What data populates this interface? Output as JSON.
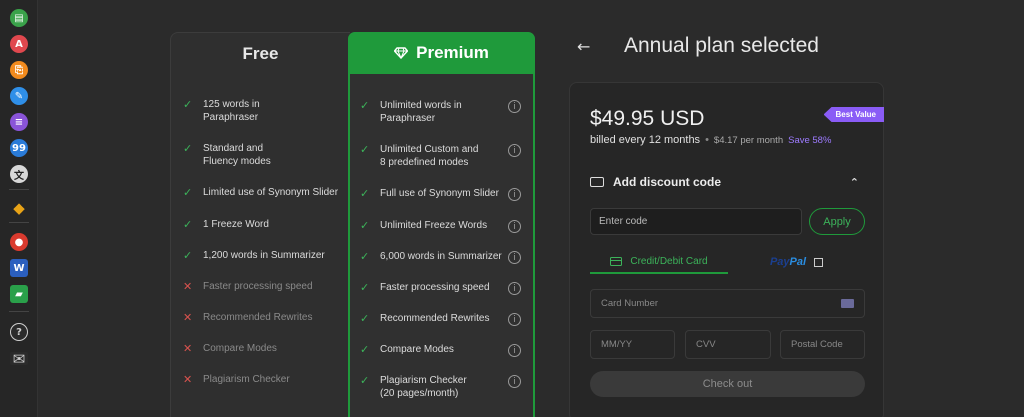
{
  "sidebar": {
    "apps": [
      {
        "name": "paraphraser-app-icon",
        "color": "#3aa24a",
        "glyph": "▤"
      },
      {
        "name": "grammar-checker-app-icon",
        "color": "#e0484e",
        "glyph": "A"
      },
      {
        "name": "plagiarism-app-icon",
        "color": "#f28b1e",
        "glyph": "⎘"
      },
      {
        "name": "co-writer-app-icon",
        "color": "#2f8fe8",
        "glyph": "✎"
      },
      {
        "name": "summarizer-app-icon",
        "color": "#8a54d8",
        "glyph": "≡"
      },
      {
        "name": "citation-app-icon",
        "color": "#2a7bd8",
        "glyph": "99"
      },
      {
        "name": "translator-app-icon",
        "color": "#d8d8d8",
        "glyph": "文"
      },
      {
        "name": "premium-app-icon",
        "color": "#e8a317",
        "glyph": "◆"
      },
      {
        "name": "chrome-extension-icon",
        "color": "#d93a2e",
        "glyph": "●"
      },
      {
        "name": "word-addin-icon",
        "color": "#2b5fbf",
        "glyph": "W"
      },
      {
        "name": "desktop-app-icon",
        "color": "#2aa04a",
        "glyph": "▰"
      },
      {
        "name": "help-icon",
        "color": "#2b2b2b",
        "glyph": "?"
      },
      {
        "name": "mail-icon",
        "color": "#2b2b2b",
        "glyph": "✉"
      }
    ]
  },
  "plans": {
    "free": {
      "title": "Free",
      "features": [
        {
          "text": "125 words in\nParaphraser",
          "included": true
        },
        {
          "text": "Standard and\nFluency modes",
          "included": true
        },
        {
          "text": "Limited use of Synonym Slider",
          "included": true
        },
        {
          "text": "1 Freeze Word",
          "included": true
        },
        {
          "text": "1,200 words in Summarizer",
          "included": true
        },
        {
          "text": "Faster processing speed",
          "included": false
        },
        {
          "text": "Recommended Rewrites",
          "included": false
        },
        {
          "text": "Compare Modes",
          "included": false
        },
        {
          "text": "Plagiarism Checker",
          "included": false
        }
      ]
    },
    "premium": {
      "title": "Premium",
      "features": [
        {
          "text": "Unlimited words in\nParaphraser"
        },
        {
          "text": "Unlimited Custom and\n8 predefined modes"
        },
        {
          "text": "Full use of Synonym Slider"
        },
        {
          "text": "Unlimited Freeze Words"
        },
        {
          "text": "6,000 words in Summarizer"
        },
        {
          "text": "Faster processing speed"
        },
        {
          "text": "Recommended Rewrites"
        },
        {
          "text": "Compare Modes"
        },
        {
          "text": "Plagiarism Checker\n(20 pages/month)"
        }
      ]
    }
  },
  "checkout": {
    "heading": "Annual plan selected",
    "price": "$49.95 USD",
    "badge": "Best Value",
    "billed": "billed every 12 months",
    "per_month": "$4.17 per month",
    "save": "Save 58%",
    "discount_label": "Add discount code",
    "code_placeholder": "Enter code",
    "apply_label": "Apply",
    "tab_card": "Credit/Debit Card",
    "tab_paypal_a": "Pay",
    "tab_paypal_b": "Pal",
    "card_number_placeholder": "Card Number",
    "expiry_placeholder": "MM/YY",
    "cvv_placeholder": "CVV",
    "postal_placeholder": "Postal Code",
    "checkout_label": "Check out"
  },
  "colors": {
    "accent_green": "#1f9a3b",
    "check_green": "#3cb35a",
    "cross_red": "#d9534f",
    "badge_purple": "#8a5cf6"
  }
}
